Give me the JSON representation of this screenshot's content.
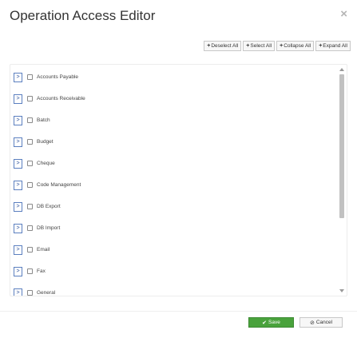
{
  "dialog": {
    "title": "Operation Access Editor",
    "close_glyph": "×"
  },
  "toolbar": {
    "deselect_all": "Deselect All",
    "select_all": "Select All",
    "collapse_all": "Collapse All",
    "expand_all": "Expand All",
    "plus": "+"
  },
  "tree": {
    "expander_glyph": ">",
    "items": [
      {
        "label": "Accounts Payable"
      },
      {
        "label": "Accounts Receivable"
      },
      {
        "label": "Batch"
      },
      {
        "label": "Budget"
      },
      {
        "label": "Cheque"
      },
      {
        "label": "Code Management"
      },
      {
        "label": "DB Export"
      },
      {
        "label": "DB Import"
      },
      {
        "label": "Email"
      },
      {
        "label": "Fax"
      },
      {
        "label": "General"
      }
    ]
  },
  "footer": {
    "save_label": "Save",
    "cancel_label": "Cancel",
    "save_icon": "✔",
    "cancel_icon": "⊘"
  },
  "colors": {
    "save": "#49a23c",
    "expander_border": "#5b7fbf"
  }
}
